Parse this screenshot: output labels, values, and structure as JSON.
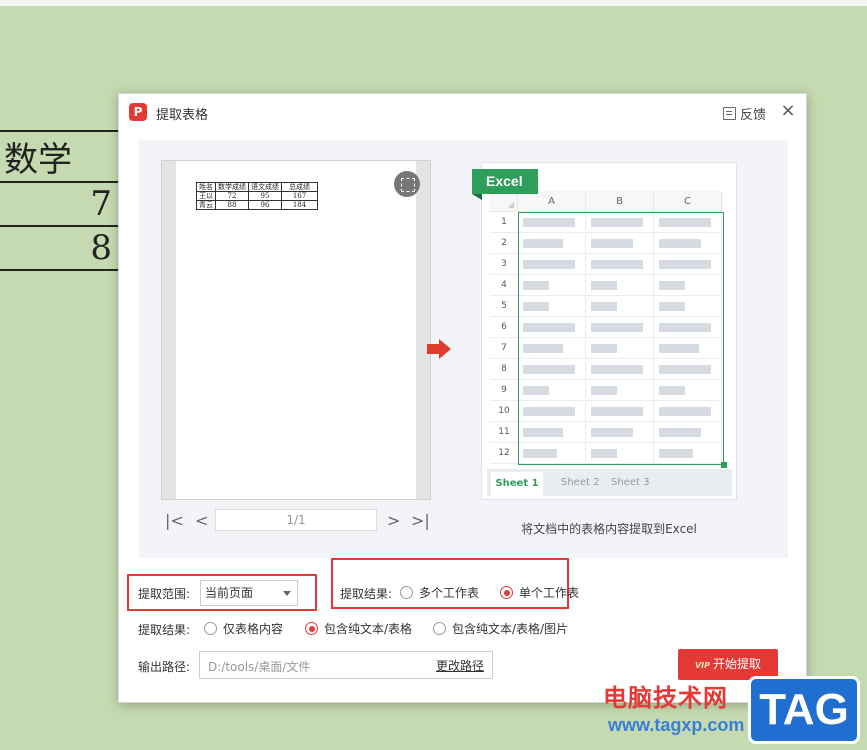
{
  "background_table": {
    "rows": [
      [
        "数学"
      ],
      [
        "7"
      ],
      [
        "8"
      ]
    ]
  },
  "dialog": {
    "title": "提取表格",
    "feedback_label": "反馈",
    "close_label": "×"
  },
  "preview": {
    "mini_table": {
      "header": [
        "姓名",
        "数学成绩",
        "语文成绩",
        "总成绩"
      ],
      "rows": [
        [
          "王以",
          "72",
          "95",
          "167"
        ],
        [
          "青云",
          "88",
          "96",
          "184"
        ]
      ]
    },
    "pager": {
      "first_label": "|<",
      "prev_label": "<",
      "indicator": "1/1",
      "next_label": ">",
      "last_label": ">|"
    }
  },
  "excel": {
    "badge": "Excel",
    "columns": [
      "A",
      "B",
      "C"
    ],
    "rows": [
      "1",
      "2",
      "3",
      "4",
      "5",
      "6",
      "7",
      "8",
      "9",
      "10",
      "11",
      "12"
    ],
    "sheets": [
      "Sheet 1",
      "Sheet 2",
      "Sheet 3"
    ],
    "caption": "将文档中的表格内容提取到Excel"
  },
  "options": {
    "range_label": "提取范围:",
    "range_value": "当前页面",
    "result_label": "提取结果:",
    "result_options": [
      "多个工作表",
      "单个工作表"
    ],
    "result_selected": 1,
    "content_label": "提取结果:",
    "content_options": [
      "仅表格内容",
      "包含纯文本/表格",
      "包含纯文本/表格/图片"
    ],
    "content_selected": 1,
    "path_label": "输出路径:",
    "path_value": "D:/tools/桌面/文件",
    "change_path_label": "更改路径",
    "start_button_vip": "VIP",
    "start_button_label": "开始提取"
  },
  "watermark": {
    "site_name": "电脑技术网",
    "url": "www.tagxp.com",
    "tag": "TAG"
  },
  "colors": {
    "desktop_bg": "#c5dab0",
    "accent_red": "#e53935",
    "excel_green": "#2e9e5b"
  }
}
